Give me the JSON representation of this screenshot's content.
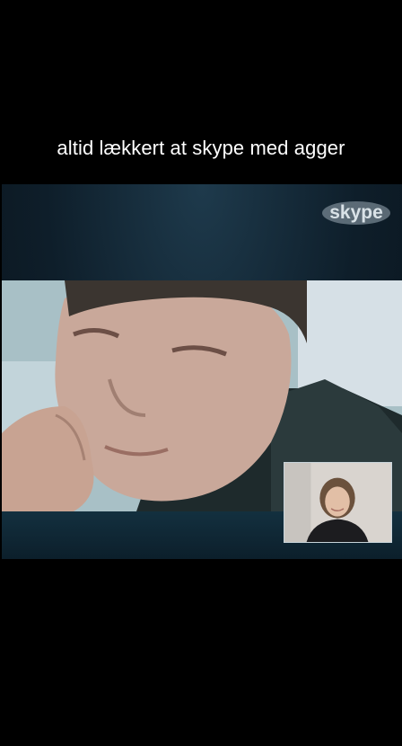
{
  "caption": "altid lækkert at skype med agger",
  "call": {
    "logo_text": "skype",
    "logo_icon": "skype-logo-icon"
  },
  "colors": {
    "background": "#000000",
    "caption_text": "#ffffff",
    "call_background": "#0e1e2a",
    "logo": "#b9c7cf"
  }
}
